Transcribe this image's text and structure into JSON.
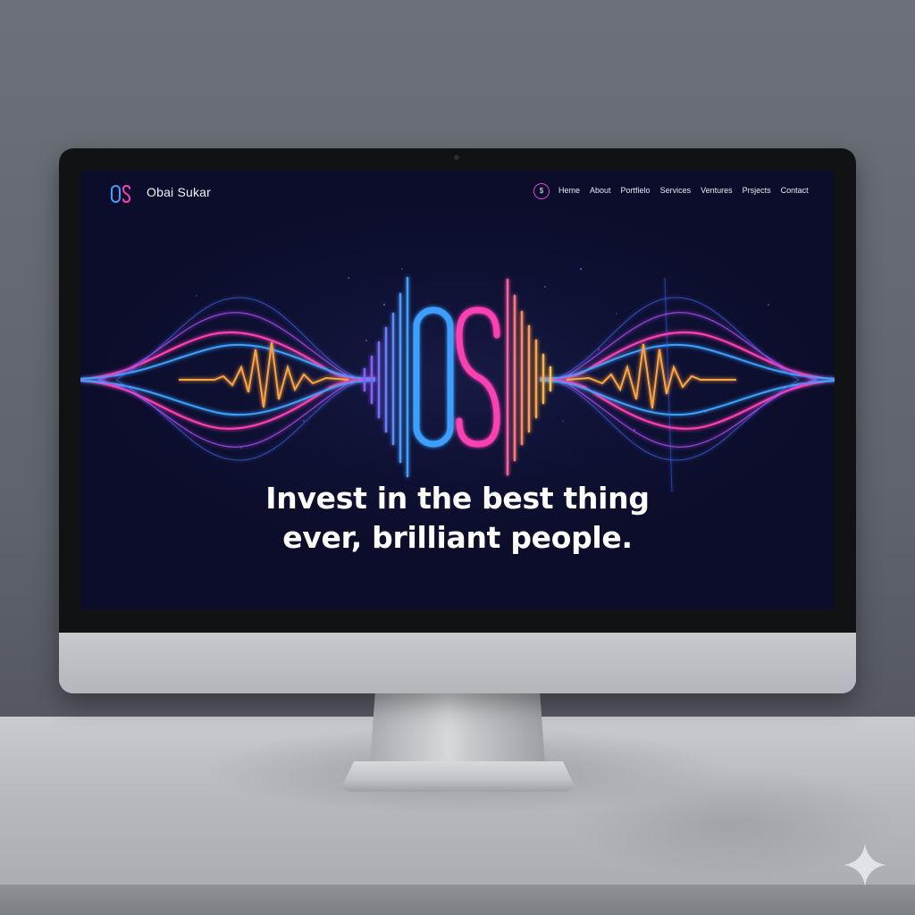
{
  "brand": {
    "name": "Obai Sukar",
    "mark_text": "OS"
  },
  "nav": {
    "icon_label": "$",
    "links": [
      "Heme",
      "About",
      "Portfielo",
      "Services",
      "Ventures",
      "Prsjects",
      "Contact"
    ]
  },
  "hero": {
    "logo_text": "OS",
    "headline_line1": "Invest in the best thing",
    "headline_line2": "ever, brilliant people."
  },
  "colors": {
    "screen_bg": "#0e1133",
    "accent_pink": "#ff3fb4",
    "accent_blue": "#3aa0ff",
    "accent_orange": "#ffa43a",
    "accent_purple": "#8a5cff"
  },
  "icons": {
    "sparkle": "sparkle-icon",
    "webcam": "camera-icon"
  }
}
